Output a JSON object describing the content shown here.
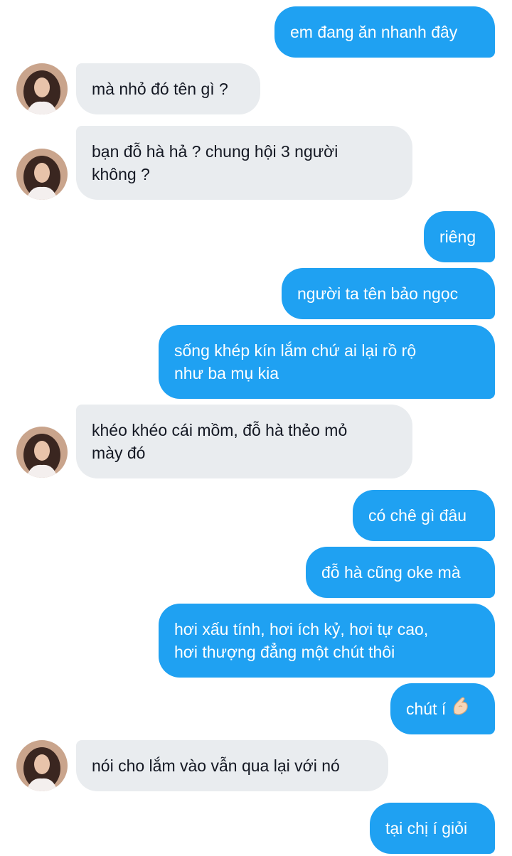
{
  "contact": {
    "avatar_icon": "contact-avatar-photo"
  },
  "messages": [
    {
      "dir": "out",
      "text": "em đang ăn nhanh đây"
    },
    {
      "dir": "in",
      "text": "mà nhỏ đó tên gì ?"
    },
    {
      "dir": "in",
      "text": "bạn đỗ hà hả ? chung hội 3 người\nkhông ?"
    },
    {
      "dir": "out",
      "text": "riêng"
    },
    {
      "dir": "out",
      "text": "người ta tên bảo ngọc"
    },
    {
      "dir": "out",
      "text": "sống khép kín lắm chứ ai lại rồ rộ\nnhư ba mụ kia"
    },
    {
      "dir": "in",
      "text": "khéo khéo cái mồm, đỗ hà thẻo mỏ\nmày đó"
    },
    {
      "dir": "out",
      "text": "có chê gì đâu"
    },
    {
      "dir": "out",
      "text": "đỗ hà cũng oke mà"
    },
    {
      "dir": "out",
      "text": "hơi xấu tính, hơi ích kỷ, hơi tự cao,\nhơi thượng đẳng một chút thôi"
    },
    {
      "dir": "out",
      "text": "chút í",
      "emoji": "pinching-hand-icon"
    },
    {
      "dir": "in",
      "text": "nói cho lắm vào vẫn qua lại với nó"
    },
    {
      "dir": "out",
      "text": "tại chị í giỏi"
    }
  ]
}
